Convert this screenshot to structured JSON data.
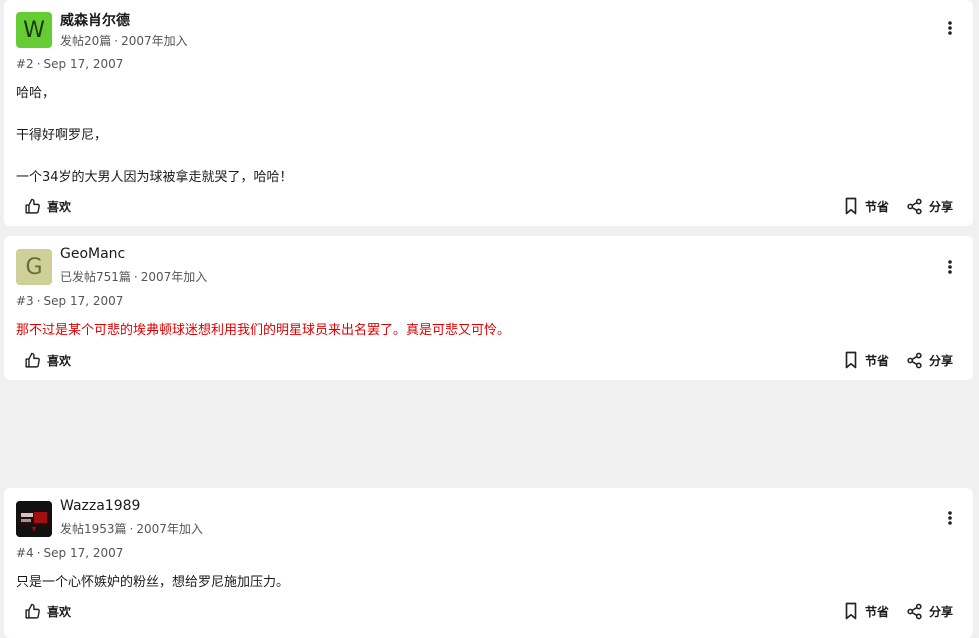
{
  "posts": [
    {
      "avatar_letter": "W",
      "avatar_color": "#66cc33",
      "avatar_text_color": "#1a3a0a",
      "username": "威森肖尔德",
      "post_count": "发帖20篇",
      "joined": "2007年加入",
      "number": "#2",
      "date": "Sep 17, 2007",
      "lines": [
        "哈哈，",
        "",
        "干得好啊罗尼，",
        "",
        "一个34岁的大男人因为球被拿走就哭了，哈哈！"
      ],
      "like_label": "喜欢",
      "save_label": "节省",
      "share_label": "分享"
    },
    {
      "avatar_letter": "G",
      "avatar_color": "#cfcf98",
      "avatar_text_color": "#6a6a40",
      "username": "GeoManc",
      "post_count": "已发帖751篇",
      "joined": "2007年加入",
      "number": "#3",
      "date": "Sep 17, 2007",
      "lines": [
        "那不过是某个可悲的埃弗顿球迷想利用我们的明星球员来出名罢了。真是可悲又可怜。"
      ],
      "text_color": "#e00000",
      "like_label": "喜欢",
      "save_label": "节省",
      "share_label": "分享"
    },
    {
      "avatar_letter": "",
      "avatar_color": "#111111",
      "username": "Wazza1989",
      "post_count": "发帖1953篇",
      "joined": "2007年加入",
      "number": "#4",
      "date": "Sep 17, 2007",
      "lines": [
        "只是一个心怀嫉妒的粉丝，想给罗尼施加压力。"
      ],
      "like_label": "喜欢",
      "save_label": "节省",
      "share_label": "分享"
    }
  ],
  "separator": "·"
}
